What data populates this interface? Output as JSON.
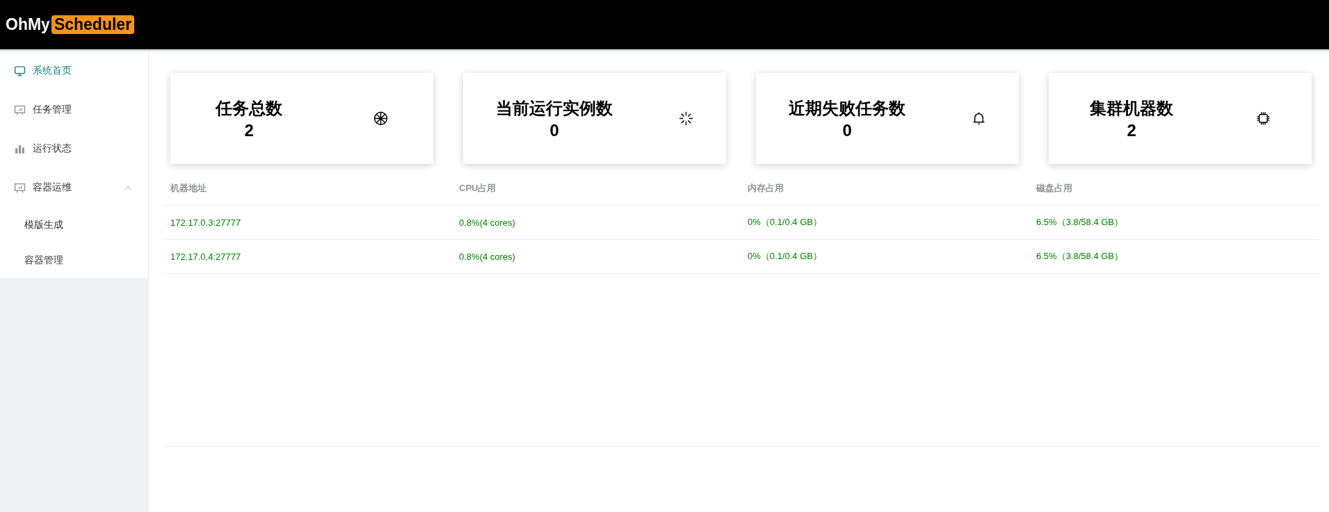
{
  "header": {
    "logo_left": "OhMy",
    "logo_right": "Scheduler"
  },
  "sidebar": {
    "items": [
      {
        "label": "系统首页",
        "selected": true
      },
      {
        "label": "任务管理",
        "selected": false
      },
      {
        "label": "运行状态",
        "selected": false
      },
      {
        "label": "容器运维",
        "selected": false,
        "expanded": true,
        "children": [
          {
            "label": "模版生成",
            "selected": false
          },
          {
            "label": "容器管理",
            "selected": false
          }
        ]
      }
    ]
  },
  "cards": [
    {
      "title": "任务总数",
      "value": "2"
    },
    {
      "title": "当前运行实例数",
      "value": "0"
    },
    {
      "title": "近期失败任务数",
      "value": "0"
    },
    {
      "title": "集群机器数",
      "value": "2"
    }
  ],
  "table": {
    "columns": [
      "机器地址",
      "CPU占用",
      "内存占用",
      "磁盘占用"
    ],
    "rows": [
      [
        "172.17.0.3:27777",
        "0.8%(4 cores)",
        "0%（0.1/0.4 GB）",
        "6.5%（3.8/58.4 GB）"
      ],
      [
        "172.17.0.4:27777",
        "0.8%(4 cores)",
        "0%（0.1/0.4 GB）",
        "6.5%（3.8/58.4 GB）"
      ]
    ]
  }
}
